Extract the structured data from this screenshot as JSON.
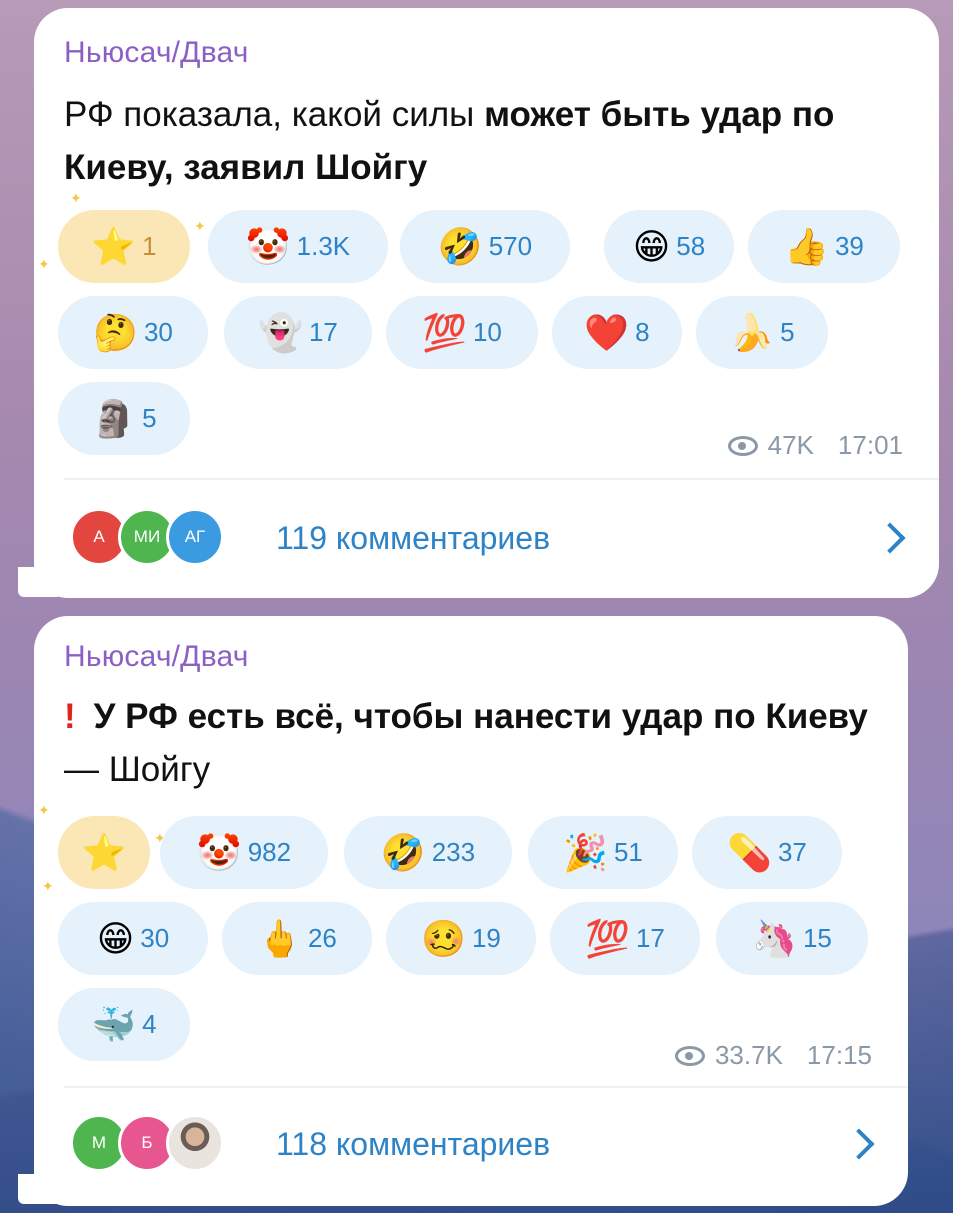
{
  "posts": [
    {
      "channel": "Ньюсач/Двач",
      "text_normal": "РФ показала, какой силы ",
      "text_bold": "может быть удар по Киеву, заявил Шойгу",
      "reactions": [
        {
          "emoji": "⭐",
          "count": "1",
          "type": "star"
        },
        {
          "emoji": "🤡",
          "count": "1.3K"
        },
        {
          "emoji": "🤣",
          "count": "570"
        },
        {
          "emoji": "😁",
          "count": "58"
        },
        {
          "emoji": "👍",
          "count": "39"
        },
        {
          "emoji": "🤔",
          "count": "30"
        },
        {
          "emoji": "👻",
          "count": "17"
        },
        {
          "emoji": "💯",
          "count": "10"
        },
        {
          "emoji": "❤️",
          "count": "8"
        },
        {
          "emoji": "🍌",
          "count": "5"
        },
        {
          "emoji": "🗿",
          "count": "5"
        }
      ],
      "views": "47K",
      "time": "17:01",
      "comments": {
        "label": "119 комментариев",
        "avatars": [
          {
            "initials": "А",
            "color": "#e2463f"
          },
          {
            "initials": "МИ",
            "color": "#4fb64f"
          },
          {
            "initials": "АГ",
            "color": "#3a9be0"
          }
        ]
      }
    },
    {
      "channel": "Ньюсач/Двач",
      "exclamation": "!",
      "text_bold": "У РФ есть всё, чтобы нанести удар по Киеву",
      "text_normal": " — Шойгу",
      "reactions": [
        {
          "emoji": "⭐",
          "count": "",
          "type": "star"
        },
        {
          "emoji": "🤡",
          "count": "982"
        },
        {
          "emoji": "🤣",
          "count": "233"
        },
        {
          "emoji": "🎉",
          "count": "51"
        },
        {
          "emoji": "💊",
          "count": "37"
        },
        {
          "emoji": "😁",
          "count": "30"
        },
        {
          "emoji": "🖕",
          "count": "26"
        },
        {
          "emoji": "🥴",
          "count": "19"
        },
        {
          "emoji": "💯",
          "count": "17"
        },
        {
          "emoji": "🦄",
          "count": "15"
        },
        {
          "emoji": "🐳",
          "count": "4"
        }
      ],
      "views": "33.7K",
      "time": "17:15",
      "comments": {
        "label": "118 комментариев",
        "avatars": [
          {
            "initials": "М",
            "color": "#4fb64f"
          },
          {
            "initials": "Б",
            "color": "#e8568f"
          },
          {
            "initials": "",
            "color": "#b9a48c"
          }
        ]
      }
    }
  ]
}
